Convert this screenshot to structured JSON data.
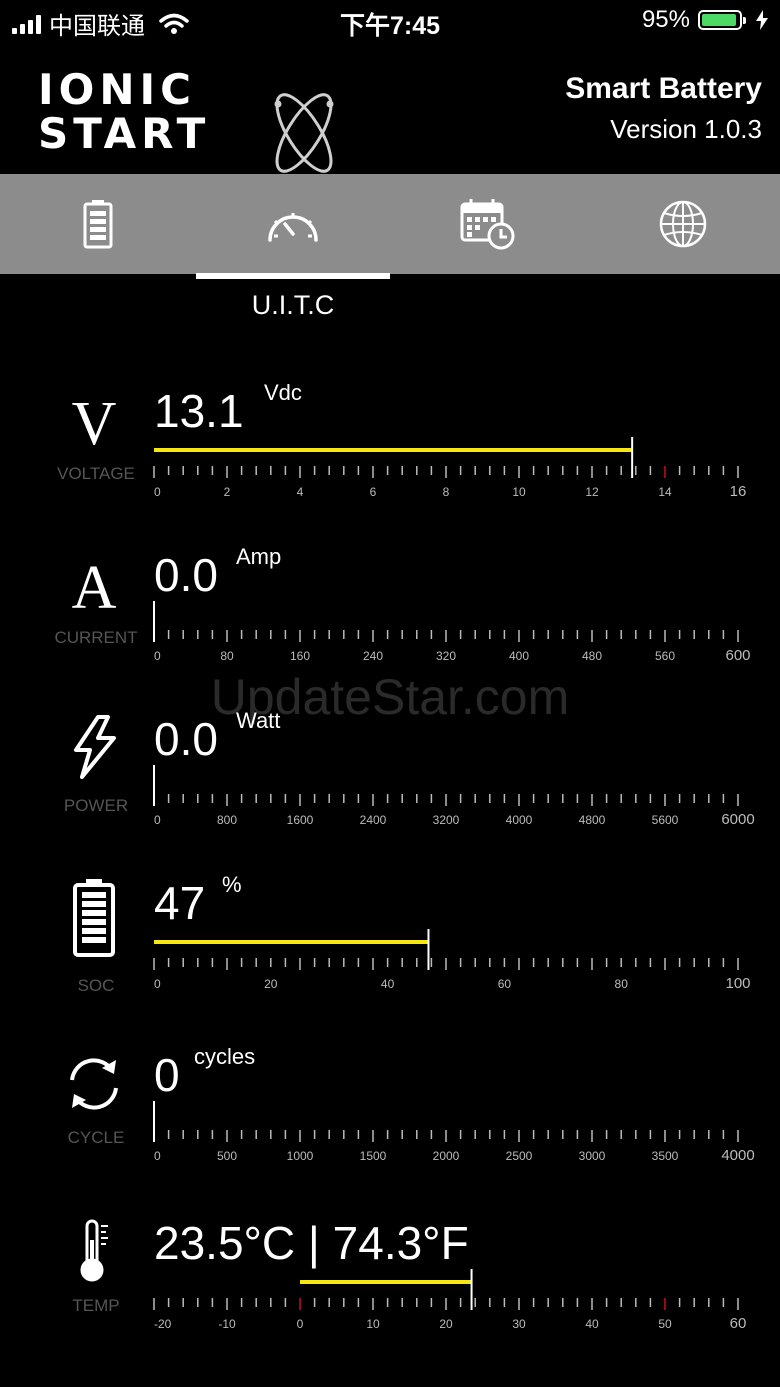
{
  "status_bar": {
    "carrier": "中国联通",
    "time": "下午7:45",
    "battery_pct": "95%",
    "battery_level": 0.95,
    "battery_color": "#4cd964"
  },
  "header": {
    "logo_line1": "IONIC",
    "logo_line2": "START",
    "app_name": "Smart Battery",
    "version": "Version 1.0.3"
  },
  "tabs": [
    {
      "icon": "battery-icon"
    },
    {
      "icon": "speedometer-icon"
    },
    {
      "icon": "calendar-clock-icon"
    },
    {
      "icon": "globe-icon"
    }
  ],
  "active_tab_label": "U.I.T.C",
  "watermark": "UpdateStar.com",
  "accent_color": "#f5e70f",
  "gauges": [
    {
      "key": "voltage",
      "symbol": "V",
      "caption": "VOLTAGE",
      "value": "13.1",
      "unit": "Vdc",
      "min": 0,
      "max": 16,
      "bar_from": 0,
      "bar_to": 13.1,
      "labels": [
        "0",
        "2",
        "4",
        "6",
        "8",
        "10",
        "12",
        "14",
        "16"
      ],
      "red_ticks": [
        14
      ]
    },
    {
      "key": "current",
      "symbol": "A",
      "caption": "CURRENT",
      "value": "0.0",
      "unit": "Amp",
      "min": 0,
      "max": 600,
      "bar_from": 0,
      "bar_to": 0,
      "labels": [
        "0",
        "80",
        "160",
        "240",
        "320",
        "400",
        "480",
        "560",
        "600"
      ],
      "red_ticks": [
        400
      ]
    },
    {
      "key": "power",
      "symbol": "bolt",
      "caption": "POWER",
      "value": "0.0",
      "unit": "Watt",
      "min": 0,
      "max": 6000,
      "bar_from": 0,
      "bar_to": 0,
      "labels": [
        "0",
        "800",
        "1600",
        "2400",
        "3200",
        "4000",
        "4800",
        "5600",
        "6000"
      ],
      "red_ticks": []
    },
    {
      "key": "soc",
      "symbol": "battery",
      "caption": "SOC",
      "value": "47",
      "unit": "%",
      "min": 0,
      "max": 100,
      "bar_from": 0,
      "bar_to": 47,
      "labels": [
        "0",
        "20",
        "40",
        "60",
        "80",
        "100"
      ],
      "red_ticks": []
    },
    {
      "key": "cycle",
      "symbol": "cycle",
      "caption": "CYCLE",
      "value": "0",
      "unit": "cycles",
      "min": 0,
      "max": 4000,
      "bar_from": 0,
      "bar_to": 0,
      "labels": [
        "0",
        "500",
        "1000",
        "1500",
        "2000",
        "2500",
        "3000",
        "3500",
        "4000"
      ],
      "red_ticks": []
    },
    {
      "key": "temp",
      "symbol": "thermometer",
      "caption": "TEMP",
      "value": "23.5°C | 74.3°F",
      "unit": "",
      "min": -20,
      "max": 60,
      "bar_from": 0,
      "bar_to": 23.5,
      "labels": [
        "-20",
        "-10",
        "0",
        "10",
        "20",
        "30",
        "40",
        "50",
        "60"
      ],
      "red_ticks": [
        0,
        50
      ]
    }
  ]
}
